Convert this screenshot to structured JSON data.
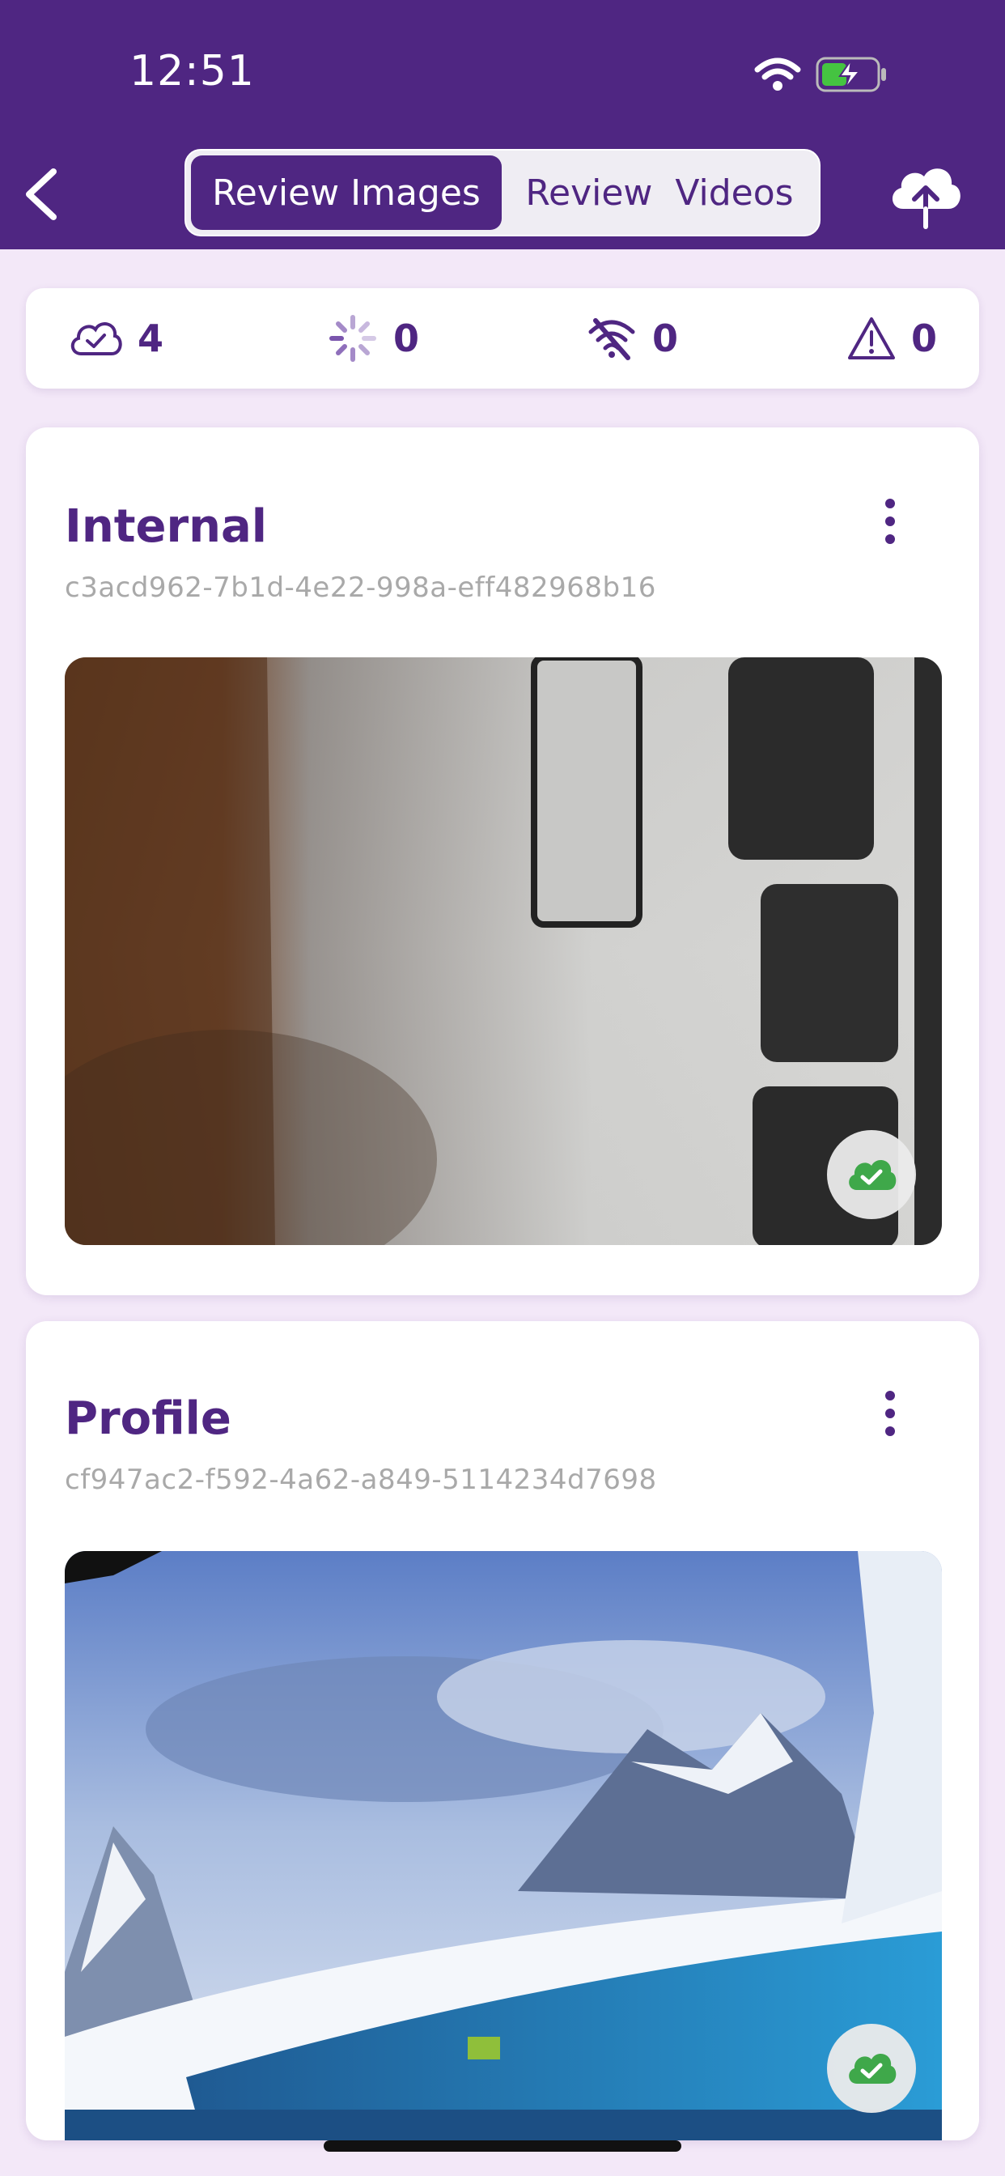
{
  "status_bar": {
    "time": "12:51"
  },
  "header": {
    "tabs": [
      {
        "label": "Review Images",
        "active": true
      },
      {
        "label": "Review  Videos",
        "active": false
      }
    ],
    "back_icon": "chevron-left-icon",
    "upload_icon": "cloud-upload-icon"
  },
  "stats": [
    {
      "icon": "cloud-check-icon",
      "value": "4"
    },
    {
      "icon": "spinner-icon",
      "value": "0"
    },
    {
      "icon": "wifi-off-icon",
      "value": "0"
    },
    {
      "icon": "warning-icon",
      "value": "0"
    }
  ],
  "cards": [
    {
      "title": "Internal",
      "id": "c3acd962-7b1d-4e22-998a-eff482968b16",
      "status": "uploaded"
    },
    {
      "title": "Profile",
      "id": "cf947ac2-f592-4a62-a849-5114234d7698",
      "status": "uploaded"
    }
  ],
  "colors": {
    "brand": "#4f2682",
    "background": "#f3e8f8",
    "success": "#3fa84a"
  }
}
